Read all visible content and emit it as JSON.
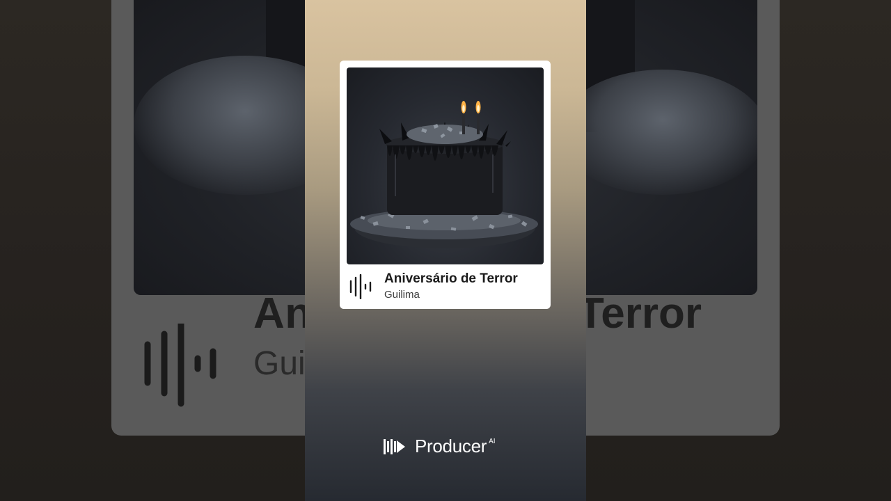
{
  "track": {
    "title": "Aniversário de Terror",
    "artist": "Guilima",
    "cover_description_icon": "black-birthday-cake-icon"
  },
  "background": {
    "title_left": "An",
    "title_right": "Terror",
    "artist_partial": "Gui"
  },
  "brand": {
    "name": "Producer",
    "suffix": "AI",
    "icon": "producer-logo-icon"
  },
  "colors": {
    "panel_top": "#d9c3a0",
    "panel_bottom": "#262a31",
    "card_bg": "#ffffff",
    "text_dark": "#1a1a1a"
  }
}
